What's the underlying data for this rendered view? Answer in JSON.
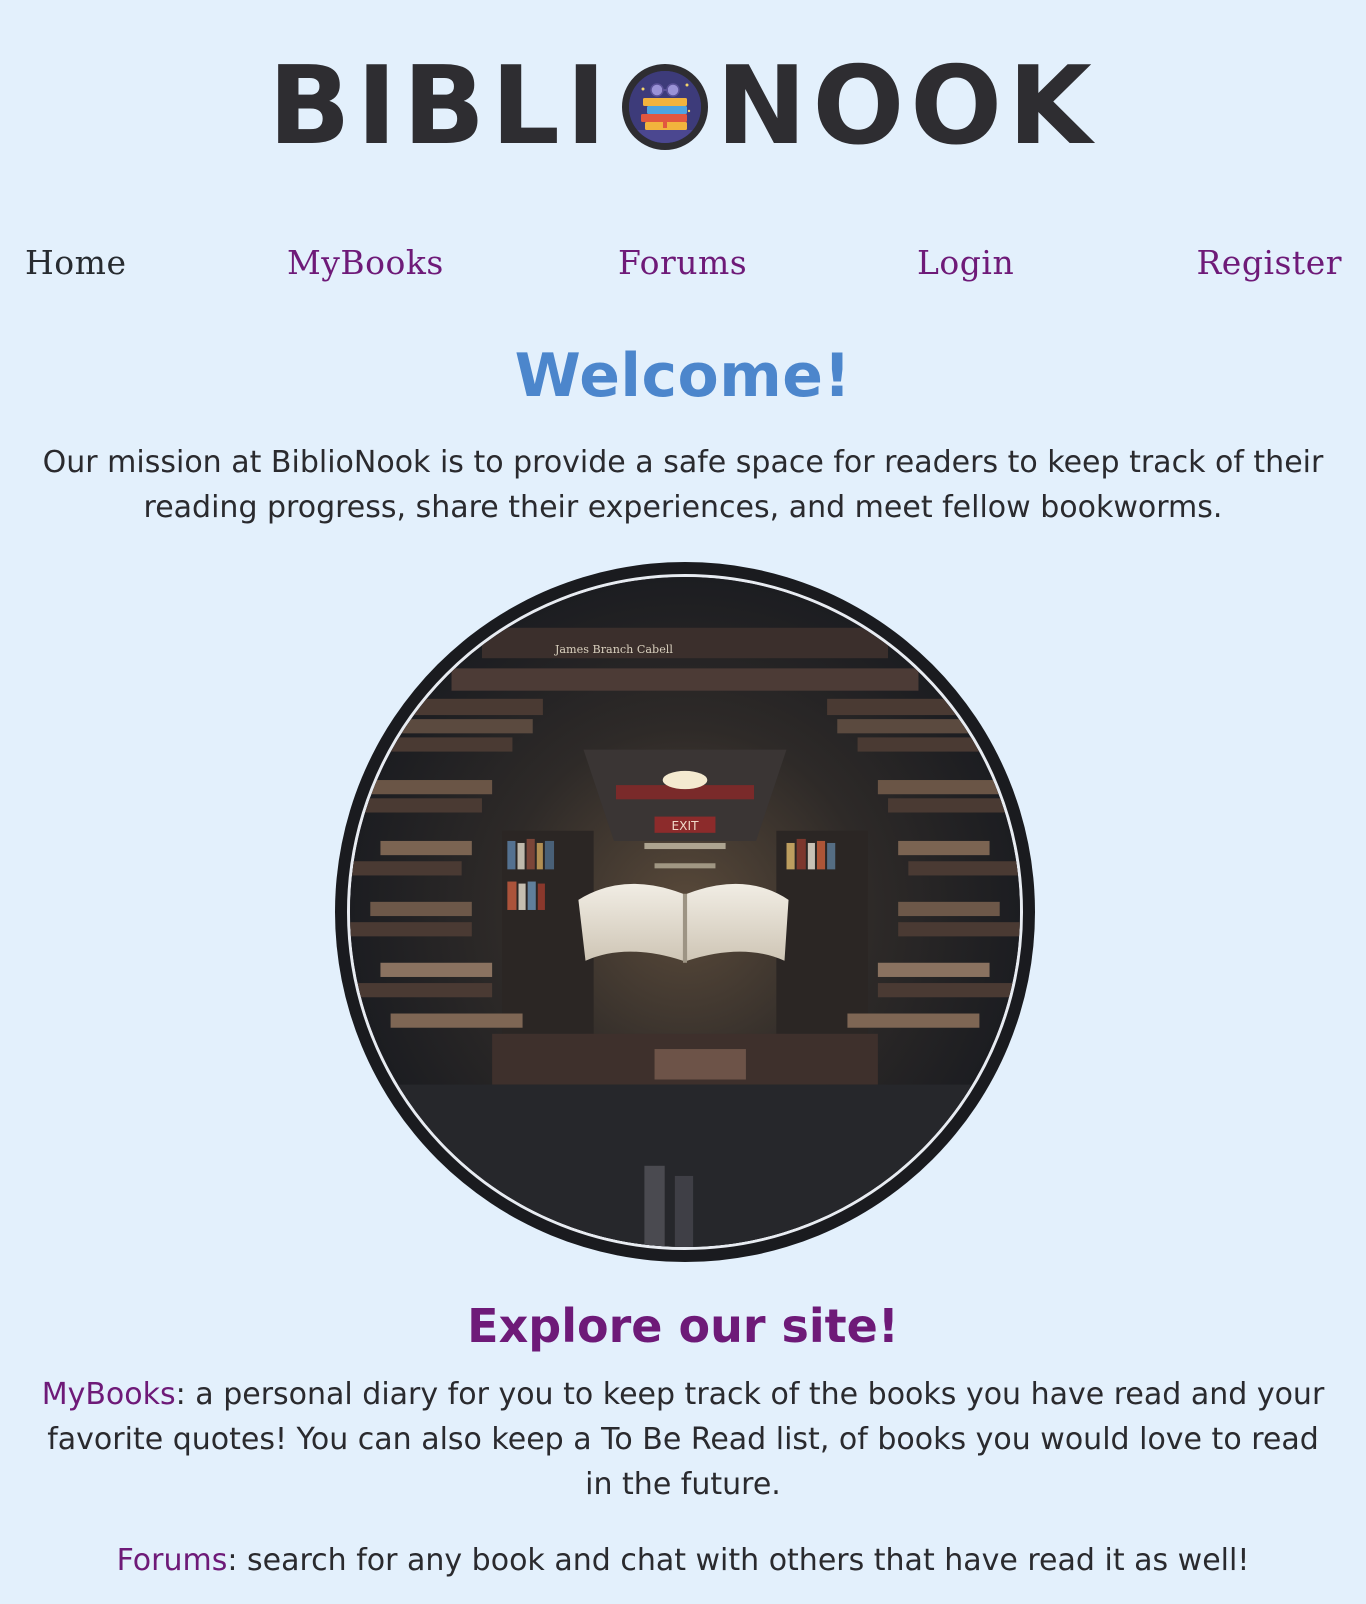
{
  "site": {
    "logo_left": "BIBLI",
    "logo_right": "NOOK"
  },
  "nav": {
    "items": [
      {
        "label": "Home",
        "active": true
      },
      {
        "label": "MyBooks",
        "active": false
      },
      {
        "label": "Forums",
        "active": false
      },
      {
        "label": "Login",
        "active": false
      },
      {
        "label": "Register",
        "active": false
      }
    ]
  },
  "welcome": {
    "title": "Welcome!",
    "mission": "Our mission at BiblioNook is to provide a safe space for readers to keep track of their reading progress, share their experiences, and meet fellow bookworms."
  },
  "hero": {
    "visible_text": [
      "James Branch Cabell",
      "EXIT"
    ]
  },
  "explore": {
    "title": "Explore our site!",
    "features": [
      {
        "name": "MyBooks",
        "description": ": a personal diary for you to keep track of the books you have read and your favorite quotes! You can also keep a To Be Read list, of books you would love to read in the future."
      },
      {
        "name": "Forums",
        "description": ": search for any book and chat with others that have read it as well!"
      }
    ]
  },
  "colors": {
    "background": "#e3f0fc",
    "link_purple": "#6e1a78",
    "welcome_blue": "#4c86cc",
    "text_dark": "#2a2a2e"
  }
}
